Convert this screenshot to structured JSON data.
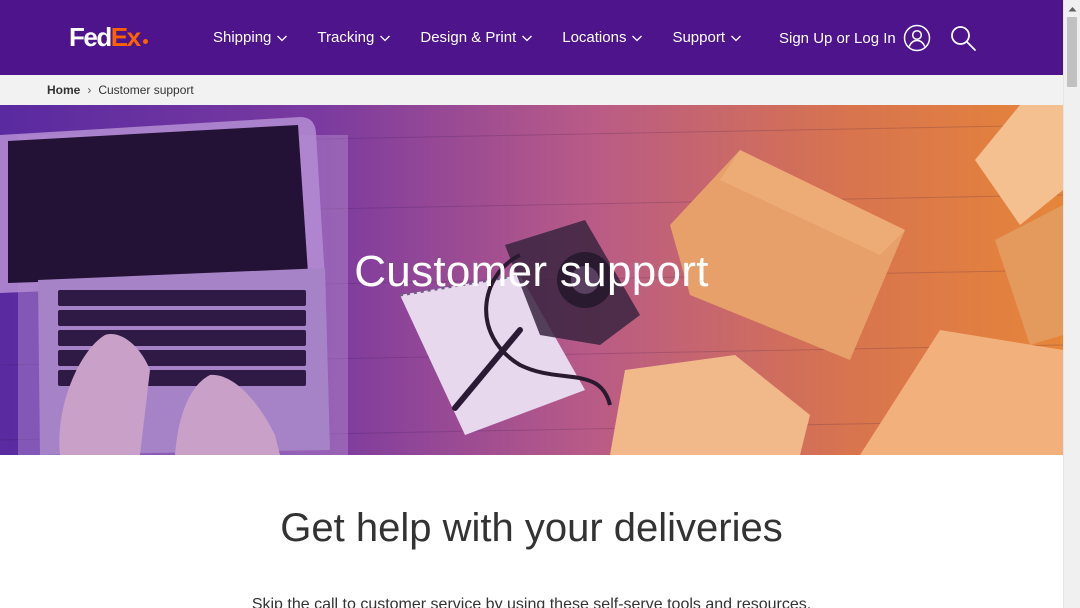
{
  "brand": {
    "part1": "Fed",
    "part2": "Ex",
    "accent": "#ff6200",
    "primary": "#4d148c"
  },
  "nav": {
    "items": [
      {
        "label": "Shipping",
        "icon": "chevron-down-icon"
      },
      {
        "label": "Tracking",
        "icon": "chevron-down-icon"
      },
      {
        "label": "Design & Print",
        "icon": "chevron-down-icon"
      },
      {
        "label": "Locations",
        "icon": "chevron-down-icon"
      },
      {
        "label": "Support",
        "icon": "chevron-down-icon"
      }
    ],
    "signin_label": "Sign Up or Log In",
    "signin_icon": "user-icon",
    "search_icon": "search-icon"
  },
  "breadcrumb": {
    "home": "Home",
    "separator": "›",
    "current": "Customer support"
  },
  "hero": {
    "title": "Customer support"
  },
  "content": {
    "title": "Get help with your deliveries",
    "subtitle": "Skip the call to customer service by using these self-serve tools and resources."
  },
  "colors": {
    "header_bg": "#4d148c",
    "breadcrumb_bg": "#f2f2f2",
    "text": "#333333"
  }
}
